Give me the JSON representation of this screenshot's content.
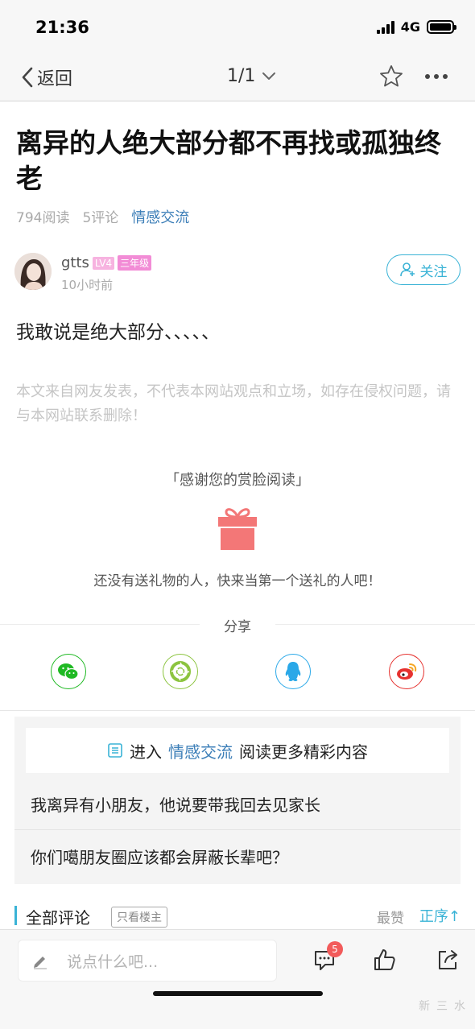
{
  "status": {
    "time": "21:36",
    "network": "4G"
  },
  "nav": {
    "back_label": "返回",
    "pager": "1/1"
  },
  "article": {
    "title": "离异的人绝大部分都不再找或孤独终老",
    "reads": "794阅读",
    "comments": "5评论",
    "category": "情感交流",
    "author": {
      "name": "gtts",
      "level": "LV4",
      "grade": "三年级",
      "time": "10小时前",
      "follow_label": "关注"
    },
    "body": "我敢说是绝大部分、、、、、",
    "disclaimer": "本文来自网友发表，不代表本网站观点和立场，如存在侵权问题，请与本网站联系删除！"
  },
  "reward": {
    "thanks": "「感谢您的赏脸阅读」",
    "empty_text": "还没有送礼物的人，快来当第一个送礼的人吧！"
  },
  "share": {
    "label": "分享",
    "targets": [
      "wechat-icon",
      "moments-icon",
      "qq-icon",
      "weibo-icon"
    ],
    "colors": {
      "wechat": "#1fb923",
      "moments": "#8cc43f",
      "qq": "#2aa8e8",
      "weibo": "#e6322f"
    }
  },
  "related": {
    "enter_prefix": "进入",
    "enter_category": "情感交流",
    "enter_suffix": "阅读更多精彩内容",
    "items": [
      "我离异有小朋友，他说要带我回去见家长",
      "你们噶朋友圈应该都会屏蔽长辈吧？"
    ]
  },
  "comments": {
    "title": "全部评论",
    "only_host": "只看楼主",
    "sort_hot": "最赞",
    "sort_order": "正序↑"
  },
  "bottom": {
    "input_placeholder": "说点什么吧...",
    "comment_count": "5",
    "watermark": "新三水"
  },
  "colors": {
    "accent": "#3ab3d6",
    "category": "#3d7fb8",
    "gift": "#f37777",
    "badge": "#f25b5b"
  }
}
